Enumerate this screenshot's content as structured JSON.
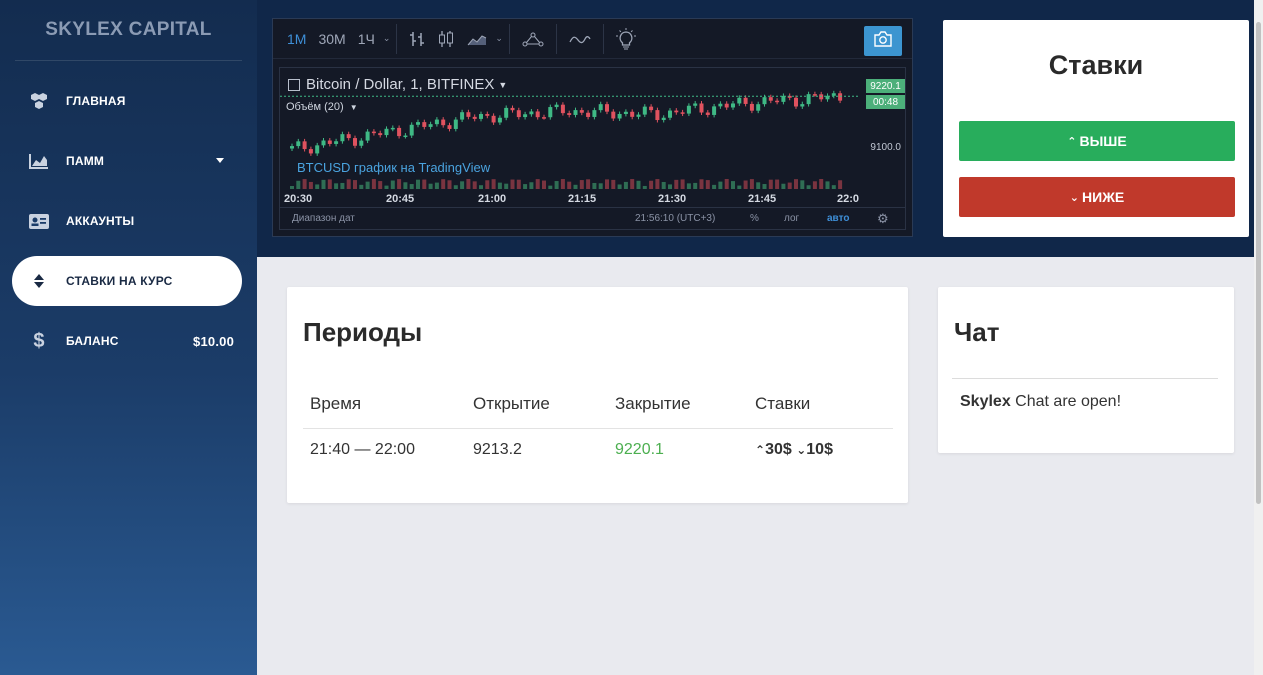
{
  "brand": "SKYLEX CAPITAL",
  "sidebar": {
    "items": [
      {
        "label": "ГЛАВНАЯ",
        "icon": "cubes-icon"
      },
      {
        "label": "ПАММ",
        "icon": "area-chart-icon"
      },
      {
        "label": "АККАУНТЫ",
        "icon": "id-card-icon"
      },
      {
        "label": "СТАВКИ НА КУРС",
        "icon": "sort-icon"
      },
      {
        "label": "БАЛАНС",
        "icon": "dollar-icon",
        "value": "$10.00"
      }
    ]
  },
  "chart": {
    "intervals": [
      "1M",
      "30M",
      "1Ч"
    ],
    "symbol": "Bitcoin / Dollar, 1, BITFINEX",
    "volume_label": "Объём (20)",
    "tv_link": "BTCUSD график на TradingView",
    "price_current": "9220.1",
    "price_timer": "00:48",
    "price_axis_tick": "9100.0",
    "time_ticks": [
      "20:30",
      "20:45",
      "21:00",
      "21:15",
      "21:30",
      "21:45",
      "22:0"
    ],
    "range_label": "Диапазон дат",
    "clock": "21:56:10 (UTC+3)",
    "opts": {
      "percent": "%",
      "log": "лог",
      "auto": "авто"
    }
  },
  "chart_data": {
    "type": "candlestick",
    "symbol": "Bitcoin / Dollar, 1, BITFINEX",
    "x": [
      "20:30",
      "20:45",
      "21:00",
      "21:15",
      "21:30",
      "21:45",
      "22:0"
    ],
    "last_price": 9220.1,
    "close_values": [
      9155,
      9175,
      9195,
      9202,
      9198,
      9212,
      9220.1
    ]
  },
  "bets": {
    "title": "Ставки",
    "up_label": "ВЫШЕ",
    "down_label": "НИЖЕ"
  },
  "periods": {
    "title": "Периоды",
    "headers": [
      "Время",
      "Открытие",
      "Закрытие",
      "Ставки"
    ],
    "row": {
      "time": "21:40 — 22:00",
      "open": "9213.2",
      "close": "9220.1",
      "bet_up": "30$",
      "bet_down": "10$"
    }
  },
  "chat": {
    "title": "Чат",
    "user": "Skylex",
    "message": "Chat are open!"
  },
  "colors": {
    "green": "#28ad5c",
    "red": "#c0392b",
    "accent_blue": "#3e8fd8"
  }
}
